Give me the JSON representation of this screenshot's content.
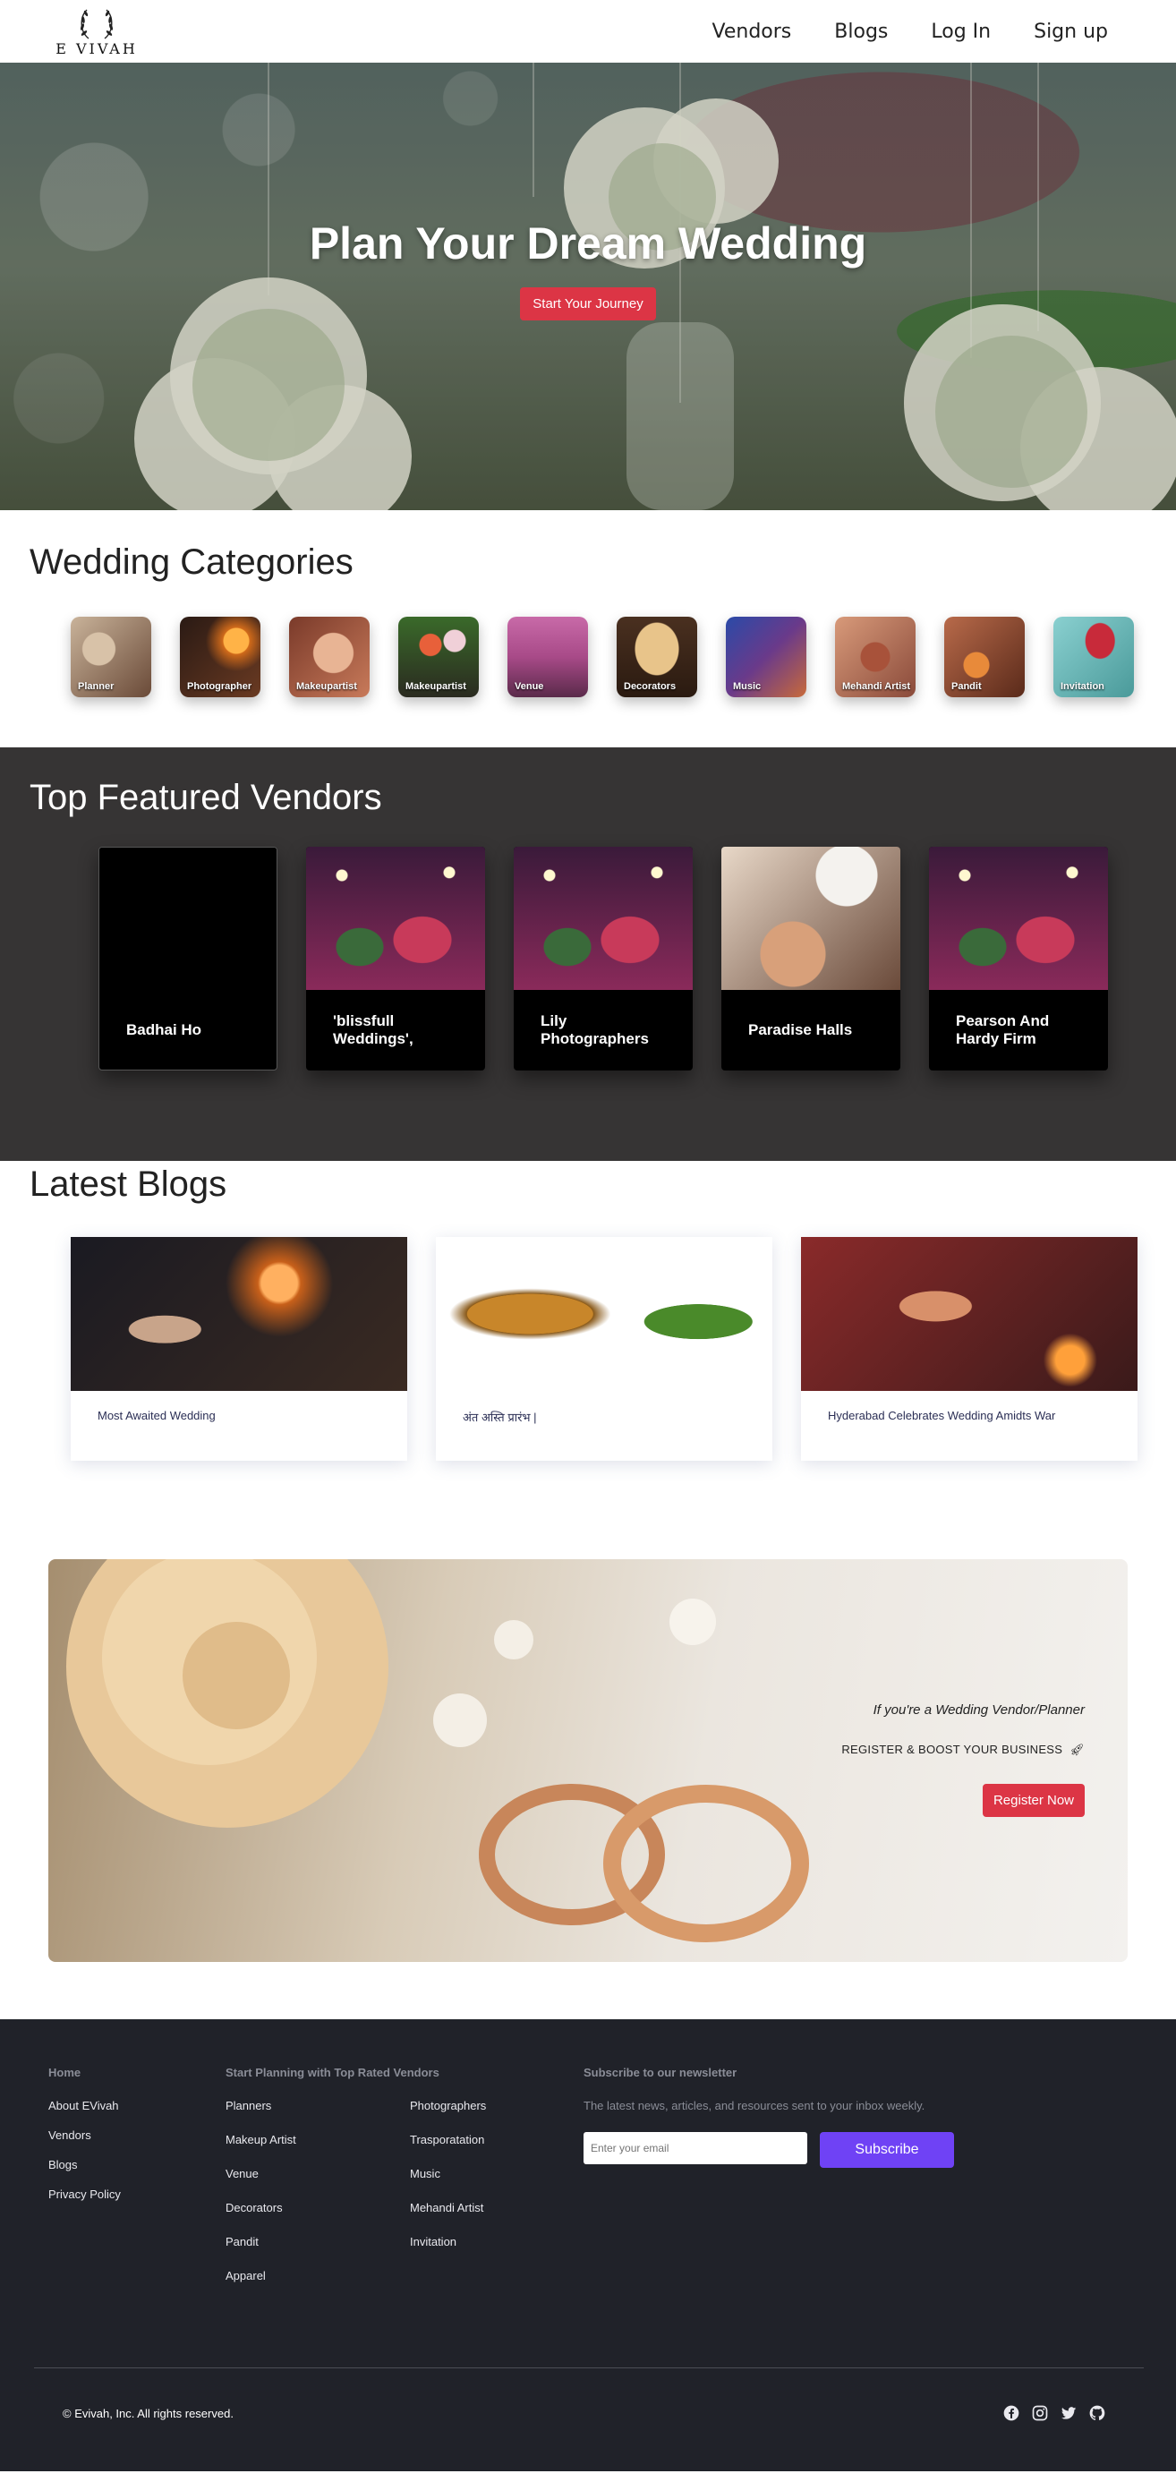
{
  "brand": {
    "name": "E VIVAH"
  },
  "nav": {
    "vendors": "Vendors",
    "blogs": "Blogs",
    "login": "Log In",
    "signup": "Sign up"
  },
  "hero": {
    "title": "Plan Your Dream Wedding",
    "cta": "Start Your Journey"
  },
  "categories": {
    "title": "Wedding Categories",
    "items": [
      {
        "label": "Planner",
        "color": "#8a6a55"
      },
      {
        "label": "Photographer",
        "color": "#4a2a1c"
      },
      {
        "label": "Makeupartist",
        "color": "#9a5a3e"
      },
      {
        "label": "Makeupartist",
        "color": "#5d3a2a"
      },
      {
        "label": "Venue",
        "color": "#a85a8a"
      },
      {
        "label": "Decorators",
        "color": "#6b4a30"
      },
      {
        "label": "Music",
        "color": "#3b4a8a"
      },
      {
        "label": "Mehandi Artist",
        "color": "#b07a5a"
      },
      {
        "label": "Pandit",
        "color": "#9a4a2a"
      },
      {
        "label": "Invitation",
        "color": "#6aa8a8"
      }
    ]
  },
  "vendors": {
    "title": "Top Featured Vendors",
    "items": [
      {
        "name": "Badhai Ho",
        "has_image": false
      },
      {
        "name": "'blissfull Weddings',",
        "has_image": true
      },
      {
        "name": "Lily Photographers",
        "has_image": true
      },
      {
        "name": "Paradise Halls",
        "has_image": true
      },
      {
        "name": "Pearson And Hardy Firm",
        "has_image": true
      }
    ]
  },
  "blogs": {
    "title": "Latest Blogs",
    "items": [
      {
        "title": "Most Awaited Wedding"
      },
      {
        "title": "अंत अस्ति प्रारंभ |"
      },
      {
        "title": "Hyderabad Celebrates Wedding Amidts War"
      }
    ]
  },
  "promo": {
    "line1": "If you're a Wedding Vendor/Planner",
    "line2": "REGISTER & BOOST YOUR BUSINESS",
    "cta": "Register Now"
  },
  "footer": {
    "col1_head": "Home",
    "col1_links": [
      "About EVivah",
      "Vendors",
      "Blogs",
      "Privacy Policy"
    ],
    "col2_head": "Start Planning with Top Rated Vendors",
    "col2_links": [
      "Planners",
      "Photographers",
      "Makeup Artist",
      "Trasporatation",
      "Venue",
      "Music",
      "Decorators",
      "Mehandi Artist",
      "Pandit",
      "Invitation",
      "Apparel"
    ],
    "news_head": "Subscribe to our newsletter",
    "news_desc": "The latest news, articles, and resources sent to your inbox weekly.",
    "news_placeholder": "Enter your email",
    "news_button": "Subscribe",
    "copyright": "© Evivah, Inc. All rights reserved.",
    "social": [
      "facebook-icon",
      "instagram-icon",
      "twitter-icon",
      "github-icon"
    ]
  },
  "colors": {
    "accent_red": "#dc3545",
    "subscribe_purple": "#6f42f5",
    "vendors_bg": "#363434",
    "footer_bg": "#202229"
  }
}
